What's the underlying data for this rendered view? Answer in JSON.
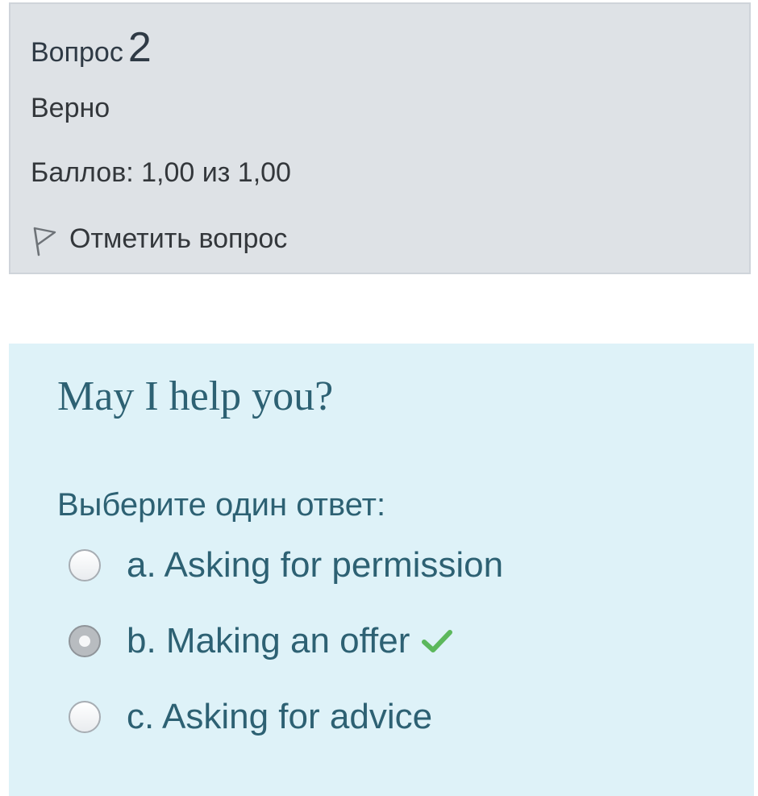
{
  "info": {
    "question_word": "Вопрос",
    "question_number": "2",
    "state": "Верно",
    "grade": "Баллов: 1,00 из 1,00",
    "flag_label": "Отметить вопрос"
  },
  "question": {
    "text": "May I help you?",
    "prompt": "Выберите один ответ:",
    "answers": [
      {
        "label": "a. Asking for permission",
        "selected": false
      },
      {
        "label": "b. Making an offer",
        "selected": true,
        "correct": true
      },
      {
        "label": "c. Asking for advice",
        "selected": false
      }
    ]
  },
  "icons": {
    "flag": "flag-outline-icon",
    "correct": "checkmark-icon"
  },
  "colors": {
    "info_bg": "#dee2e6",
    "content_bg": "#def2f8",
    "text_teal": "#2d6173",
    "correct_green": "#5cb85c"
  }
}
